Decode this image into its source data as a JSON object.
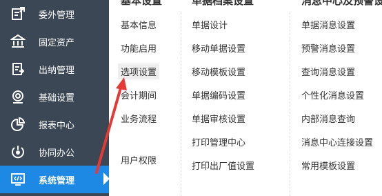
{
  "sidebar": {
    "items": [
      {
        "label": "委外管理",
        "icon": "outsourcing-icon"
      },
      {
        "label": "固定资产",
        "icon": "bank-building-icon"
      },
      {
        "label": "出纳管理",
        "icon": "cashier-document-icon"
      },
      {
        "label": "基础设置",
        "icon": "settings-gear-icon"
      },
      {
        "label": "报表中心",
        "icon": "pie-chart-icon"
      },
      {
        "label": "协同办公",
        "icon": "collaboration-icon"
      },
      {
        "label": "系统管理",
        "icon": "system-monitor-icon",
        "active": true
      }
    ],
    "colors": {
      "background": "#3b4754",
      "active": "#1e88e5"
    }
  },
  "columns": [
    {
      "header": "基本设置",
      "items": [
        "基本信息",
        "功能启用",
        "选项设置",
        "会计期间",
        "业务流程",
        "用户权限"
      ]
    },
    {
      "header": "单据档案设置",
      "items": [
        "单据设计",
        "移动单据设置",
        "移动模板设置",
        "单据编码设置",
        "单据审核设置",
        "打印管理中心",
        "打印出厂值设置"
      ]
    },
    {
      "header": "消息中心及预警设",
      "items": [
        "单据消息设置",
        "预警消息设置",
        "查询消息设置",
        "个性化消息设置",
        "内部消息查询",
        "消息中心连接设置",
        "常用模板设置"
      ]
    }
  ],
  "annotation": {
    "type": "red-arrow",
    "color": "#e53935",
    "target": "选项设置"
  }
}
